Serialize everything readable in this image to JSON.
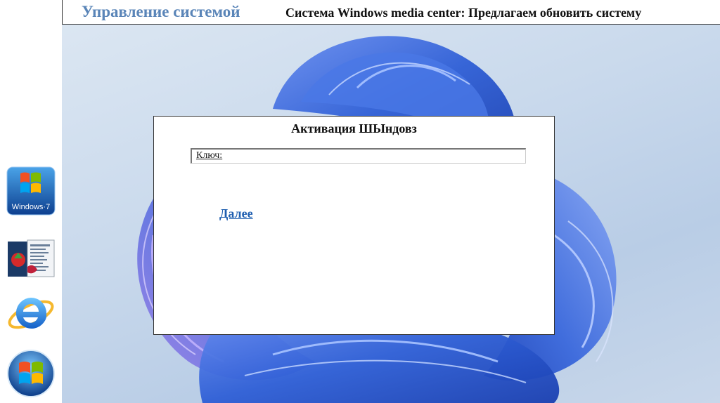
{
  "header": {
    "title": "Управление системой",
    "subtitle": "Система Windows media center: Предлагаем обновить систему"
  },
  "sidebar": {
    "icons": [
      {
        "name": "windows7-icon",
        "label": "Windows·7"
      },
      {
        "name": "application-icon"
      },
      {
        "name": "internet-explorer-icon"
      },
      {
        "name": "windows-logo-icon"
      }
    ]
  },
  "dialog": {
    "title": "Активация ШЫндовз",
    "key_label": "Ключ:",
    "next_link": "Далее"
  },
  "colors": {
    "header_title": "#5a85b8",
    "link": "#1f5fb0",
    "wallpaper_bloom": "#2f5fd6"
  }
}
